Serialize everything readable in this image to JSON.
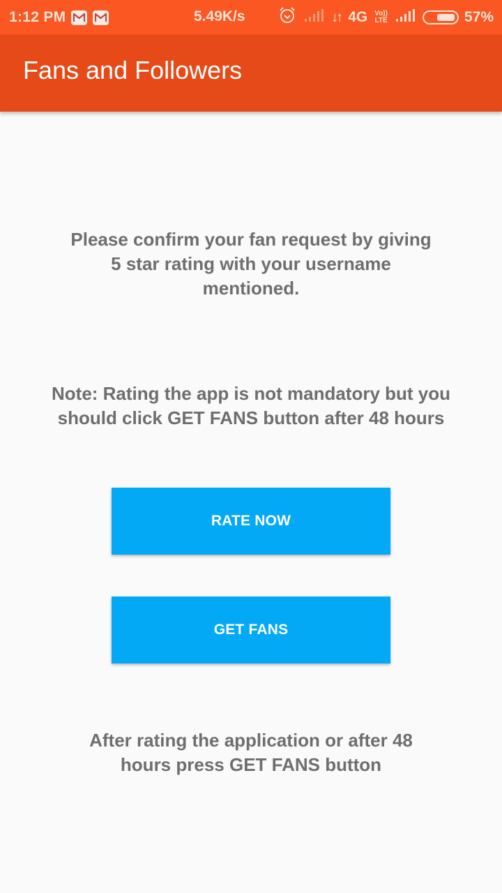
{
  "status_bar": {
    "time": "1:12 PM",
    "notification_icons": [
      "gmail-icon",
      "gmail-icon"
    ],
    "network_speed": "5.49K/s",
    "alarm_icon": "alarm-icon",
    "network_arrows": "↓↑",
    "network_type": "4G",
    "volte_line1": "Vo))",
    "volte_line2": "LTE",
    "battery_percent": "57%",
    "battery_level": 0.57
  },
  "app_bar": {
    "title": "Fans and Followers"
  },
  "main": {
    "confirm_message": "Please confirm your fan request by giving 5 star rating with your username mentioned.",
    "note_message": "Note: Rating the app is not mandatory but you should click GET FANS button after 48 hours",
    "rate_button_label": "RATE NOW",
    "get_fans_button_label": "GET FANS",
    "footer_message": "After rating the application or after 48 hours press GET FANS  button"
  },
  "colors": {
    "status_bar": "#fb5722",
    "app_bar": "#e64a19",
    "button": "#03a9f4",
    "text": "#6e6e6e",
    "background": "#fafafa"
  }
}
